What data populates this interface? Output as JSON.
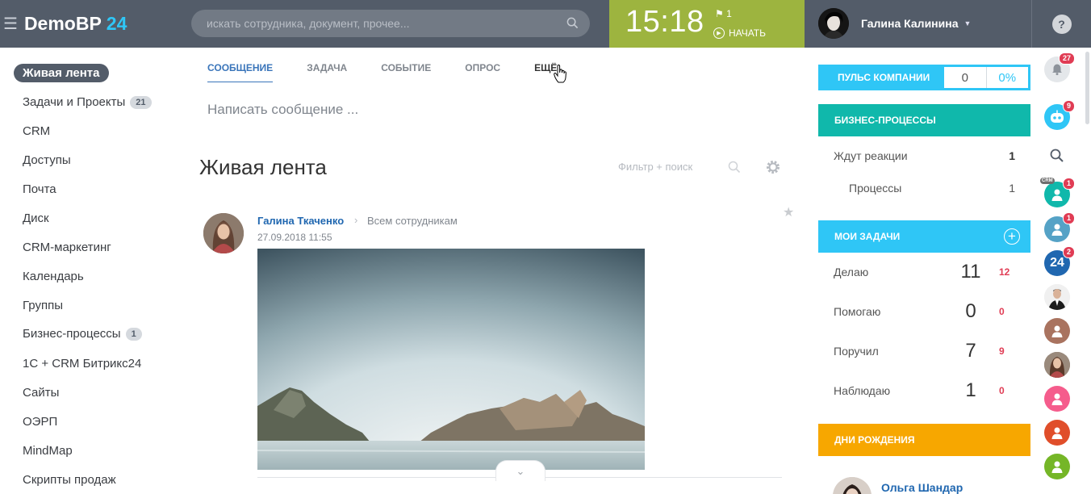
{
  "header": {
    "logo_name": "DemoBP",
    "logo_num": "24",
    "search_placeholder": "искать сотрудника, документ, прочее...",
    "time": "15:18",
    "flag_count": "1",
    "start_label": "НАЧАТЬ",
    "user_name": "Галина Калинина",
    "help": "?"
  },
  "sidebar": {
    "items": [
      {
        "label": "Живая лента",
        "active": true
      },
      {
        "label": "Задачи и Проекты",
        "badge": "21"
      },
      {
        "label": "CRM"
      },
      {
        "label": "Доступы"
      },
      {
        "label": "Почта"
      },
      {
        "label": "Диск"
      },
      {
        "label": "CRM-маркетинг"
      },
      {
        "label": "Календарь"
      },
      {
        "label": "Группы"
      },
      {
        "label": "Бизнес-процессы",
        "badge": "1"
      },
      {
        "label": "1С + CRM Битрикс24"
      },
      {
        "label": "Сайты"
      },
      {
        "label": "ОЭРП"
      },
      {
        "label": "MindMap"
      },
      {
        "label": "Скрипты продаж"
      }
    ]
  },
  "composer": {
    "tabs": [
      "СООБЩЕНИЕ",
      "ЗАДАЧА",
      "СОБЫТИЕ",
      "ОПРОС",
      "ЕЩЁ"
    ],
    "placeholder": "Написать сообщение ..."
  },
  "feed": {
    "title": "Живая лента",
    "filter_label": "Фильтр + поиск",
    "post": {
      "author": "Галина Ткаченко",
      "recipient": "Всем сотрудникам",
      "date": "27.09.2018 11:55"
    }
  },
  "right_panel": {
    "pulse": {
      "label": "ПУЛЬС КОМПАНИИ",
      "value": "0",
      "percent": "0%"
    },
    "bp": {
      "title": "БИЗНЕС-ПРОЦЕССЫ",
      "rows": [
        {
          "label": "Ждут реакции",
          "value": "1"
        },
        {
          "label": "Процессы",
          "value": "1"
        }
      ]
    },
    "tasks": {
      "title": "МОИ ЗАДАЧИ",
      "rows": [
        {
          "label": "Делаю",
          "value": "11",
          "overdue": "12"
        },
        {
          "label": "Помогаю",
          "value": "0",
          "overdue": "0"
        },
        {
          "label": "Поручил",
          "value": "7",
          "overdue": "9"
        },
        {
          "label": "Наблюдаю",
          "value": "1",
          "overdue": "0"
        }
      ]
    },
    "birthdays": {
      "title": "ДНИ РОЖДЕНИЯ",
      "name": "Ольга Шандар"
    }
  },
  "right_bar": {
    "notifications": "27",
    "bot_count": "9",
    "crm_tag": "CRM",
    "crm_count": "1",
    "user2_count": "1",
    "b24_label": "24",
    "b24_count": "2"
  },
  "colors": {
    "header_bg": "#535c69",
    "accent": "#2fc6f6",
    "clock_bg": "#9db43f",
    "bp_head": "#10b8ab",
    "birthday_head": "#f7a700",
    "link": "#2067b0"
  }
}
